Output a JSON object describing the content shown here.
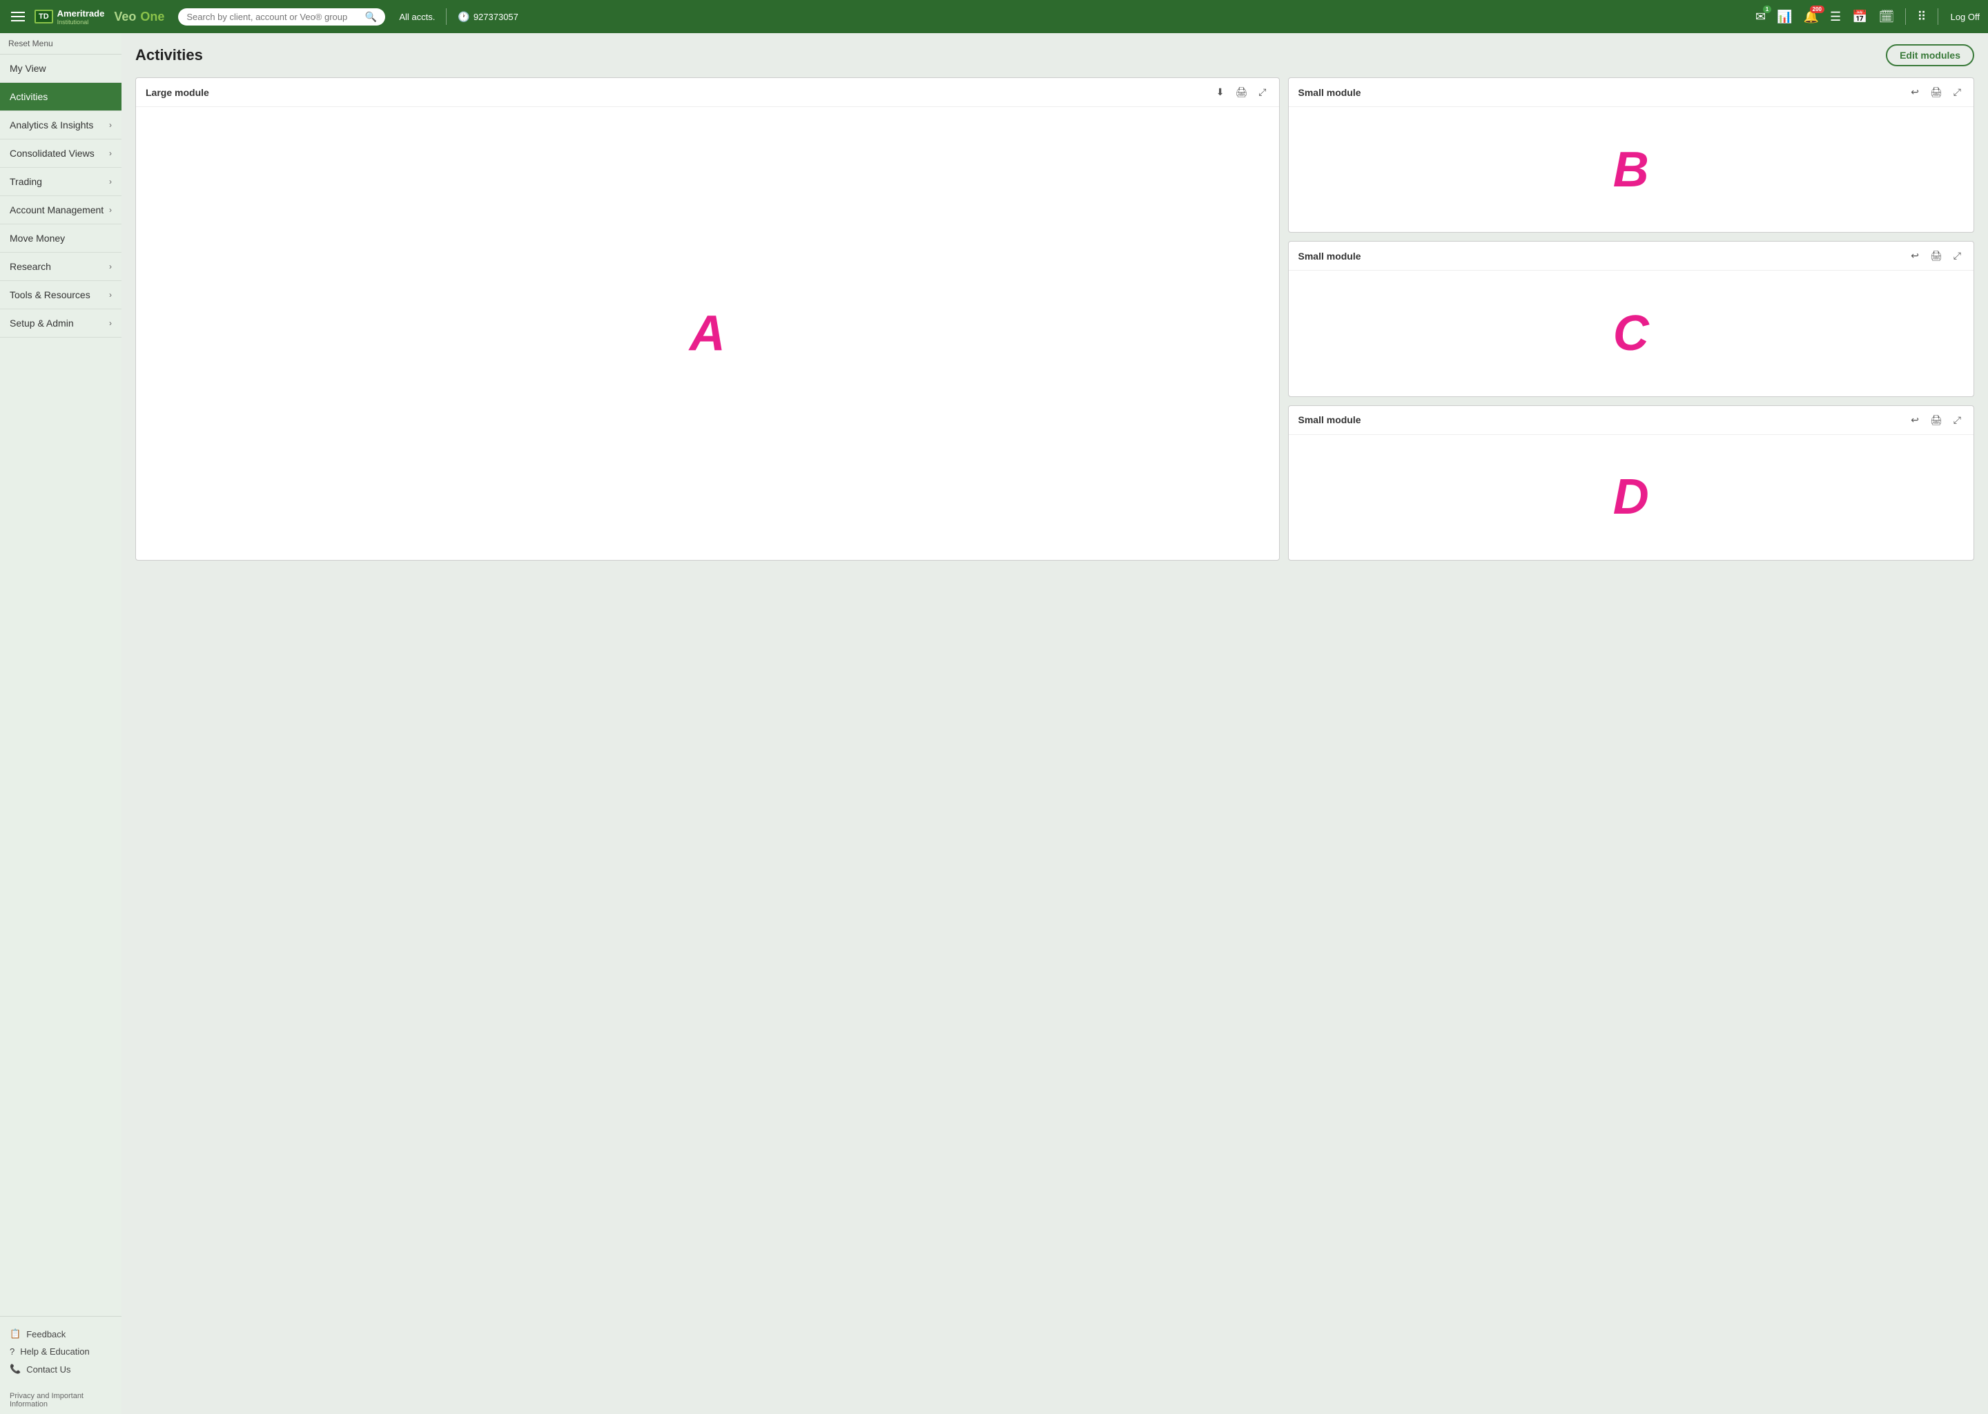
{
  "topnav": {
    "hamburger_label": "Menu",
    "logo_td": "TD",
    "logo_ameritrade": "Ameritrade",
    "logo_institutional": "Institutional",
    "logo_veo": "Veo",
    "logo_one": "One",
    "search_placeholder": "Search by client, account or Veo® group",
    "all_accts": "All accts.",
    "phone_number": "927373057",
    "badge_mail": "1",
    "badge_notifications": "200",
    "logoff_label": "Log Off"
  },
  "sidebar": {
    "reset_menu": "Reset Menu",
    "items": [
      {
        "id": "my-view",
        "label": "My View",
        "has_chevron": false
      },
      {
        "id": "activities",
        "label": "Activities",
        "has_chevron": false,
        "active": true
      },
      {
        "id": "analytics",
        "label": "Analytics & Insights",
        "has_chevron": true
      },
      {
        "id": "consolidated",
        "label": "Consolidated Views",
        "has_chevron": true
      },
      {
        "id": "trading",
        "label": "Trading",
        "has_chevron": true
      },
      {
        "id": "account-mgmt",
        "label": "Account Management",
        "has_chevron": true
      },
      {
        "id": "move-money",
        "label": "Move Money",
        "has_chevron": false
      },
      {
        "id": "research",
        "label": "Research",
        "has_chevron": true
      },
      {
        "id": "tools",
        "label": "Tools & Resources",
        "has_chevron": true
      },
      {
        "id": "setup",
        "label": "Setup & Admin",
        "has_chevron": true
      }
    ],
    "footer": [
      {
        "id": "feedback",
        "label": "Feedback",
        "icon": "📋"
      },
      {
        "id": "help",
        "label": "Help & Education",
        "icon": "❓"
      },
      {
        "id": "contact",
        "label": "Contact Us",
        "icon": "📞"
      }
    ],
    "privacy": "Privacy and Important Information"
  },
  "content": {
    "page_title": "Activities",
    "edit_modules_label": "Edit modules",
    "modules": [
      {
        "id": "large",
        "title": "Large module",
        "placeholder": "A",
        "size": "large"
      },
      {
        "id": "small-b",
        "title": "Small module",
        "placeholder": "B",
        "size": "small"
      },
      {
        "id": "small-c",
        "title": "Small module",
        "placeholder": "C",
        "size": "small"
      },
      {
        "id": "small-d",
        "title": "Small module",
        "placeholder": "D",
        "size": "small"
      }
    ]
  }
}
